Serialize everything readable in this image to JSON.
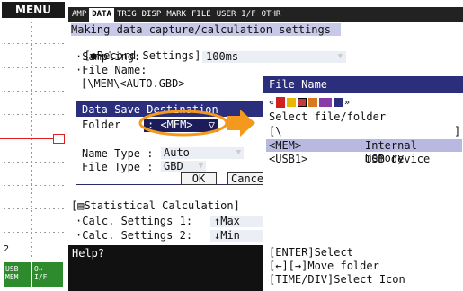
{
  "menu_label": "MENU",
  "usb_badge": {
    "line1": "USB",
    "line2": "MEM"
  },
  "io_badge": {
    "line1": "O↔",
    "line2": "I/F"
  },
  "left_marker": "2",
  "tabs": [
    "AMP",
    "DATA",
    "TRIG",
    "DISP",
    "MARK",
    "FILE",
    "USER",
    "I/F",
    "OTHR"
  ],
  "main": {
    "heading": "Making data capture/calculation settings",
    "record_settings": "[●Record Settings]",
    "sampling_label": "·Sampling:",
    "sampling_value": "100ms",
    "file_name_label": "·File Name:",
    "file_name_value": "[\\MEM\\<AUTO.GBD>",
    "statistical": "[▤Statistical Calculation]",
    "calc1_label": "·Calc. Settings 1:",
    "calc1_value": "↑Max",
    "calc2_label": "·Calc. Settings 2:",
    "calc2_value": "↓Min",
    "help": "Help?"
  },
  "dialog": {
    "title": "Data Save Destination",
    "folder_label": "Folder",
    "folder_value": "<MEM>",
    "name_type_label": "Name Type :",
    "name_type_value": "Auto",
    "file_type_label": "File Type :",
    "file_type_value": "GBD",
    "ok": "OK",
    "cancel": "Cance"
  },
  "file_panel": {
    "title": "File Name",
    "prompt": "Select file/folder",
    "path_open": "[\\",
    "path_close": "]",
    "rows": [
      {
        "name": "<MEM>",
        "desc": "Internal memory",
        "selected": true
      },
      {
        "name": "<USB1>",
        "desc": "USB device",
        "selected": false
      }
    ],
    "help1": "[ENTER]Select",
    "help2": "[←][→]Move folder",
    "help3": "[TIME/DIV]Select Icon"
  },
  "colors": {
    "title_bar": "#2b2e7a",
    "highlight": "#b8b8e0",
    "callout": "#f39a1e",
    "record_dot": "#e00000"
  }
}
